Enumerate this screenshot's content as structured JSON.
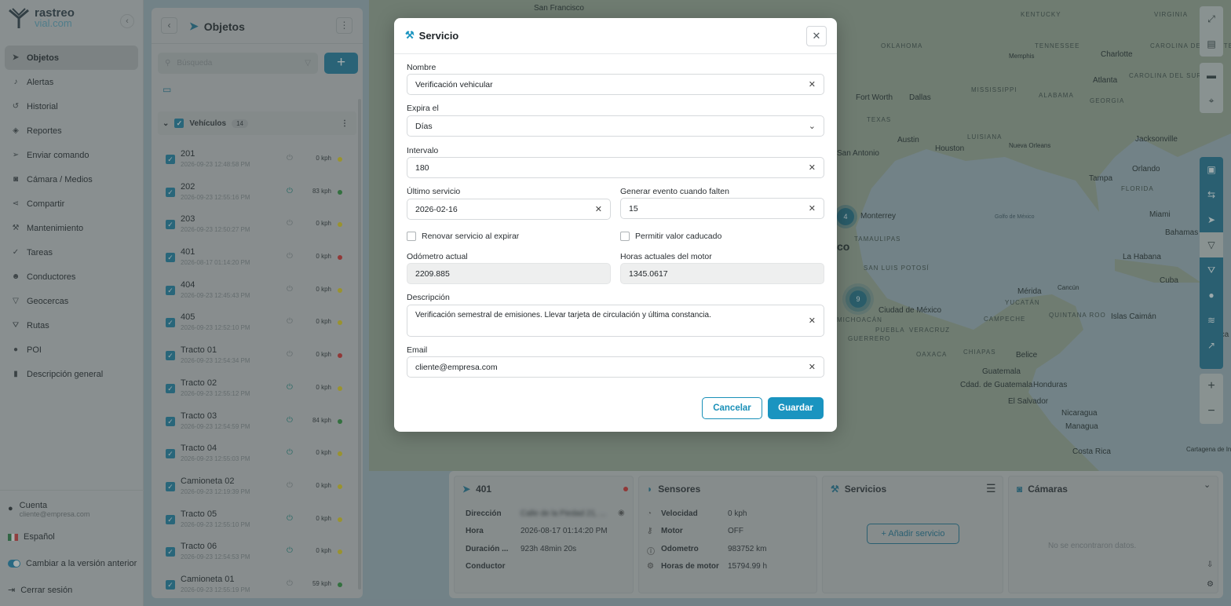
{
  "app": {
    "logo_top": "rastreo",
    "logo_bottom": "vial.com"
  },
  "sidebar": {
    "items": [
      {
        "label": "Objetos",
        "icon": "location-arrow-icon",
        "active": true
      },
      {
        "label": "Alertas",
        "icon": "bell-icon"
      },
      {
        "label": "Historial",
        "icon": "history-icon"
      },
      {
        "label": "Reportes",
        "icon": "layers-icon"
      },
      {
        "label": "Enviar comando",
        "icon": "send-icon"
      },
      {
        "label": "Cámara / Medios",
        "icon": "camera-icon"
      },
      {
        "label": "Compartir",
        "icon": "share-icon"
      },
      {
        "label": "Mantenimiento",
        "icon": "wrench-icon"
      },
      {
        "label": "Tareas",
        "icon": "tasks-icon"
      },
      {
        "label": "Conductores",
        "icon": "users-icon"
      },
      {
        "label": "Geocercas",
        "icon": "geofence-icon"
      },
      {
        "label": "Rutas",
        "icon": "road-icon"
      },
      {
        "label": "POI",
        "icon": "pin-icon"
      },
      {
        "label": "Descripción general",
        "icon": "bar-chart-icon"
      }
    ],
    "account_label": "Cuenta",
    "account_email": "cliente@empresa.com",
    "language": "Español",
    "switch_version": "Cambiar a la versión anterior",
    "logout": "Cerrar sesión"
  },
  "objects_panel": {
    "title": "Objetos",
    "search_placeholder": "Búsqueda",
    "group_name": "Vehículos",
    "group_count": "14",
    "vehicles": [
      {
        "name": "201",
        "time": "2026-09-23 12:48:58 PM",
        "speed": "0 kph",
        "status": "#d4c21f",
        "ignition": false
      },
      {
        "name": "202",
        "time": "2026-09-23 12:55:16 PM",
        "speed": "83 kph",
        "status": "#2e8a3a",
        "ignition": true
      },
      {
        "name": "203",
        "time": "2026-09-23 12:50:27 PM",
        "speed": "0 kph",
        "status": "#d4c21f",
        "ignition": false
      },
      {
        "name": "401",
        "time": "2026-08-17 01:14:20 PM",
        "speed": "0 kph",
        "status": "#c6302e",
        "ignition": false
      },
      {
        "name": "404",
        "time": "2026-09-23 12:45:43 PM",
        "speed": "0 kph",
        "status": "#d4c21f",
        "ignition": false
      },
      {
        "name": "405",
        "time": "2026-09-23 12:52:10 PM",
        "speed": "0 kph",
        "status": "#d4c21f",
        "ignition": false
      },
      {
        "name": "Tracto 01",
        "time": "2026-09-23 12:54:34 PM",
        "speed": "0 kph",
        "status": "#c6302e",
        "ignition": false
      },
      {
        "name": "Tracto 02",
        "time": "2026-09-23 12:55:12 PM",
        "speed": "0 kph",
        "status": "#d4c21f",
        "ignition": true
      },
      {
        "name": "Tracto 03",
        "time": "2026-09-23 12:54:59 PM",
        "speed": "84 kph",
        "status": "#2e8a3a",
        "ignition": true
      },
      {
        "name": "Tracto 04",
        "time": "2026-09-23 12:55:03 PM",
        "speed": "0 kph",
        "status": "#d4c21f",
        "ignition": true
      },
      {
        "name": "Camioneta 02",
        "time": "2026-09-23 12:19:39 PM",
        "speed": "0 kph",
        "status": "#d4c21f",
        "ignition": false
      },
      {
        "name": "Tracto 05",
        "time": "2026-09-23 12:55:10 PM",
        "speed": "0 kph",
        "status": "#d4c21f",
        "ignition": true
      },
      {
        "name": "Tracto 06",
        "time": "2026-09-23 12:54:53 PM",
        "speed": "0 kph",
        "status": "#d4c21f",
        "ignition": true
      },
      {
        "name": "Camioneta 01",
        "time": "2026-09-23 12:55:19 PM",
        "speed": "59 kph",
        "status": "#2e8a3a",
        "ignition": false
      }
    ]
  },
  "map_labels": [
    "San Francisco",
    "KENTUCKY",
    "VIRGINIA",
    "OKLAHOMA",
    "Memphis",
    "TENNESSEE",
    "Charlotte",
    "CAROLINA DEL NORTE",
    "Atlanta",
    "CAROLINA DEL SUR",
    "MISSISSIPPI",
    "ALABAMA",
    "GEORGIA",
    "Fort Worth",
    "Dallas",
    "TEXAS",
    "Austin",
    "Houston",
    "LUISIANA",
    "Nueva Orleans",
    "Jacksonville",
    "San Antonio",
    "Orlando",
    "Tampa",
    "FLORIDA",
    "Monterrey",
    "Golfo de México",
    "Miami",
    "Bahamas",
    "TAMAULIPAS",
    "La Habana",
    "SAN LUIS POTOSÍ",
    "Cuba",
    "Mérida",
    "Cancún",
    "YUCATÁN",
    "Ciudad de México",
    "CAMPECHE",
    "QUINTANA ROO",
    "Islas Caimán",
    "Jamaica",
    "PUEBLA",
    "VERACRUZ",
    "GUERRERO",
    "OAXACA",
    "CHIAPAS",
    "Belice",
    "Guatemala",
    "Honduras",
    "Cdad. de Guatemala",
    "El Salvador",
    "Nicaragua",
    "Managua",
    "Costa Rica",
    "Cartagena de Indias",
    "MICHOACÁN",
    "co"
  ],
  "map_clusters": [
    "4",
    "9"
  ],
  "bottom": {
    "object": {
      "title": "401",
      "rows": [
        {
          "k": "Dirección",
          "v": "Calle de la Piedad 21, ..."
        },
        {
          "k": "Hora",
          "v": "2026-08-17 01:14:20 PM"
        },
        {
          "k": "Duración ...",
          "v": "923h 48min 20s"
        },
        {
          "k": "Conductor",
          "v": ""
        }
      ]
    },
    "sensors": {
      "title": "Sensores",
      "rows": [
        {
          "k": "Velocidad",
          "v": "0 kph",
          "icon": "gauge-icon"
        },
        {
          "k": "Motor",
          "v": "OFF",
          "icon": "key-icon"
        },
        {
          "k": "Odometro",
          "v": "983752 km",
          "icon": "info-icon"
        },
        {
          "k": "Horas de motor",
          "v": "15794.99 h",
          "icon": "engine-icon"
        }
      ]
    },
    "services": {
      "title": "Servicios",
      "add_label": "+ Añadir servicio"
    },
    "cameras": {
      "title": "Cámaras",
      "empty": "No se encontraron datos."
    }
  },
  "modal": {
    "title": "Servicio",
    "name_label": "Nombre",
    "name_value": "Verificación vehicular",
    "expires_label": "Expira el",
    "expires_value": "Días",
    "interval_label": "Intervalo",
    "interval_value": "180",
    "last_service_label": "Último servicio",
    "last_service_value": "2026-02-16",
    "trigger_label": "Generar evento cuando falten",
    "trigger_value": "15",
    "renew_label": "Renovar servicio al expirar",
    "allow_expired_label": "Permitir valor caducado",
    "odometer_label": "Odómetro actual",
    "odometer_value": "2209.885",
    "engine_hours_label": "Horas actuales del motor",
    "engine_hours_value": "1345.0617",
    "description_label": "Descripción",
    "description_value": "Verificación semestral de emisiones. Llevar tarjeta de circulación y última constancia.",
    "email_label": "Email",
    "email_value": "cliente@empresa.com",
    "cancel_label": "Cancelar",
    "save_label": "Guardar"
  },
  "colors": {
    "accent": "#1a94c0",
    "moving": "#2e8a3a",
    "idle": "#d4c21f",
    "offline": "#c6302e"
  }
}
